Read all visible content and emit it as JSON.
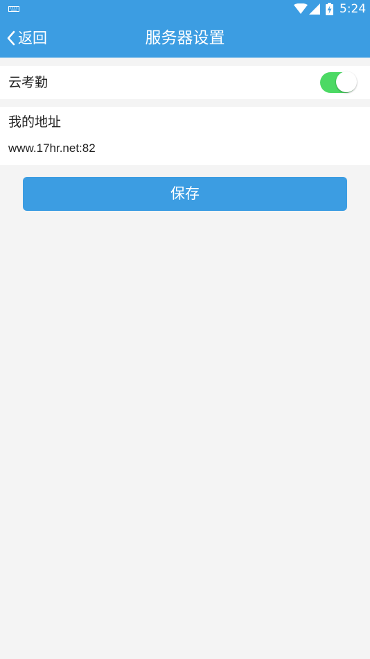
{
  "colors": {
    "accent": "#3c9de2",
    "switch_on": "#4cd964",
    "background": "#f4f4f4",
    "row_background": "#ffffff",
    "text": "#222222"
  },
  "status_bar": {
    "time": "5:24",
    "icons": [
      "keyboard-icon",
      "wifi-icon",
      "cell-signal-icon",
      "battery-charging-icon"
    ]
  },
  "header": {
    "back_label": "返回",
    "title": "服务器设置"
  },
  "settings": {
    "cloud_attendance": {
      "label": "云考勤",
      "enabled": true
    },
    "address": {
      "label": "我的地址",
      "value": "www.17hr.net:82"
    }
  },
  "actions": {
    "save_label": "保存"
  }
}
